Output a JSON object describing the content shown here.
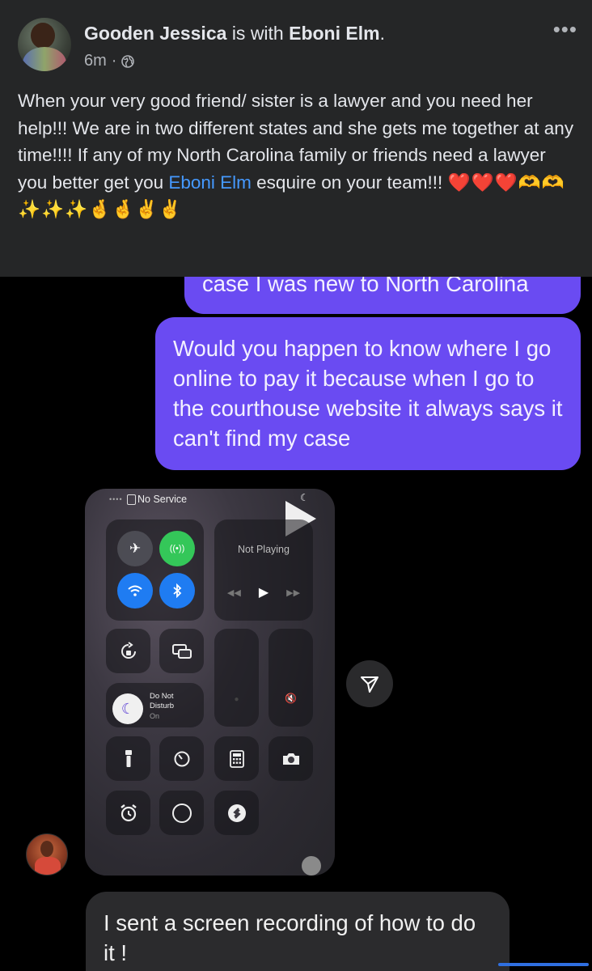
{
  "post": {
    "author": "Gooden Jessica",
    "with_word": "is with",
    "tagged": "Eboni Elm",
    "time": "6m",
    "separator": "·",
    "text_1": "When your very good friend/ sister is a lawyer and you need her help!!! We are in two different states and she gets me together at any time!!!! If any of my North Carolina family or friends need a lawyer you better get you ",
    "text_tag": "Eboni Elm",
    "text_2": " esquire on your team!!! ",
    "text_emoji": "❤️❤️❤️🫶🫶 ✨✨✨🤞🤞✌️✌️",
    "more_label": "•••",
    "icons": {
      "privacy": "globe-icon",
      "more": "more-dots-icon"
    }
  },
  "conversation": {
    "sent_1": "case I was new to North Carolina",
    "sent_2": "Would you happen to know where I go online to pay it because when I go to the courthouse website it always says it can't find my case",
    "received_1": "I sent a screen recording of how to do it !",
    "colors": {
      "sent_bubble": "#6a4bf2",
      "received_bubble": "#2b2b2d"
    }
  },
  "recording": {
    "status_text": "No Service",
    "now_playing": "Not Playing",
    "dnd_title_1": "Do Not",
    "dnd_title_2": "Disturb",
    "dnd_state": "On",
    "icons": [
      "airplane-icon",
      "cellular-icon",
      "wifi-icon",
      "bluetooth-icon",
      "rotation-lock-icon",
      "screen-mirror-icon",
      "moon-icon",
      "flashlight-icon",
      "timer-icon",
      "calculator-icon",
      "camera-icon",
      "alarm-icon",
      "record-icon",
      "shazam-icon"
    ],
    "colors": {
      "cellular_on": "#34c759",
      "wifi_on": "#1f7cf2",
      "bluetooth_on": "#1f7cf2"
    }
  }
}
